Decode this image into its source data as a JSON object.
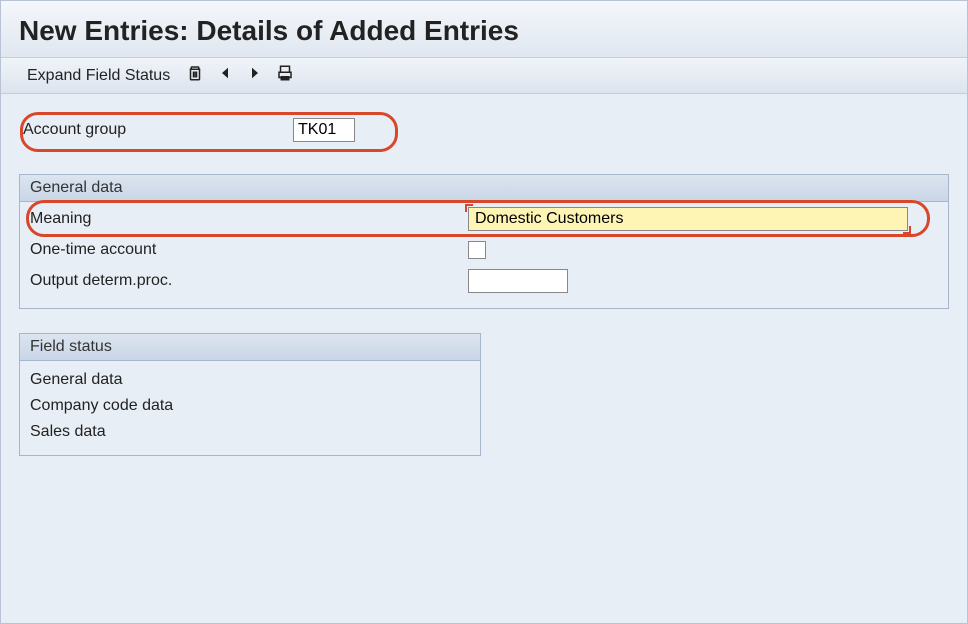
{
  "header": {
    "title": "New Entries: Details of Added Entries"
  },
  "toolbar": {
    "expand_label": "Expand Field Status"
  },
  "account_group": {
    "label": "Account group",
    "value": "TK01"
  },
  "general_panel": {
    "title": "General data",
    "meaning_label": "Meaning",
    "meaning_value": "Domestic Customers",
    "onetime_label": "One-time account",
    "output_label": "Output determ.proc.",
    "output_value": ""
  },
  "status_panel": {
    "title": "Field status",
    "items": [
      "General data",
      "Company code data",
      "Sales data"
    ]
  }
}
